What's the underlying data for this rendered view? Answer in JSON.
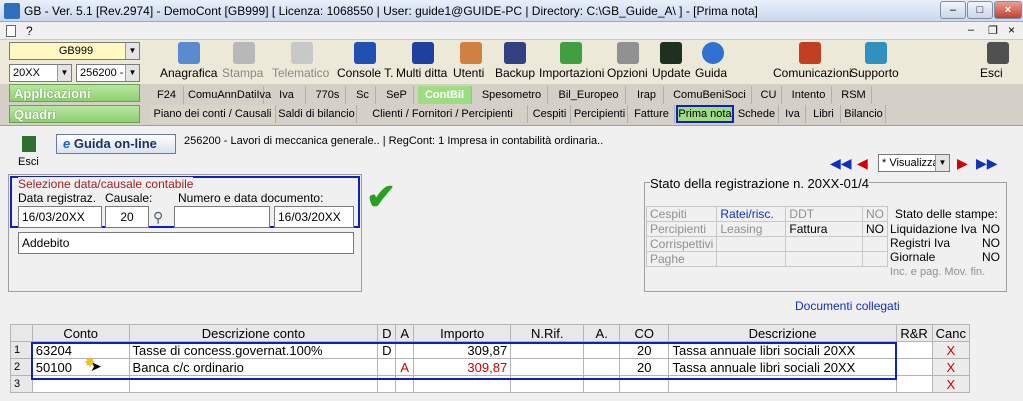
{
  "window": {
    "title": "GB - Ver. 5.1 [Rev.2974] - DemoCont [GB999]    [ Licenza: 1068550 | User: guide1@GUIDE-PC | Directory: C:\\GB_Guide_A\\ ] - [Prima nota]"
  },
  "menubar": {
    "help_label": "?"
  },
  "selectors": {
    "company": "GB999",
    "year": "20XX",
    "code": "256200 -"
  },
  "toolbar": {
    "buttons": [
      "Anagrafica",
      "Stampa",
      "Telematico",
      "Console T.",
      "Multi ditta",
      "Utenti",
      "Backup",
      "Importazioni",
      "Opzioni",
      "Update",
      "Guida",
      "Comunicazioni",
      "Supporto",
      "Esci"
    ]
  },
  "sections": {
    "applicazioni": "Applicazioni",
    "quadri": "Quadri"
  },
  "tabs_apps": [
    "F24",
    "ComuAnnDatiIva",
    "Iva",
    "770s",
    "Sc",
    "SeP",
    "ContBil",
    "Spesometro",
    "Bil_Europeo",
    "Irap",
    "ComuBeniSoci",
    "CU",
    "Intento",
    "RSM"
  ],
  "tabs_quadri": [
    "Piano dei conti / Causali",
    "Saldi di bilancio",
    "Clienti / Fornitori / Percipienti",
    "Cespiti",
    "Percipienti",
    "Fatture",
    "Prima nota",
    "Schede",
    "Iva",
    "Libri",
    "Bilancio"
  ],
  "panel": {
    "esci_label": "Esci",
    "guida_label": "Guida on-line",
    "info": "256200 - Lavori di meccanica generale..  | RegCont: 1 Impresa  in contabilità ordinaria..",
    "visualizza": "* Visualizza"
  },
  "selezione": {
    "legend": "Selezione data/causale contabile",
    "data_label": "Data registraz.",
    "causale_label": "Causale:",
    "numero_label": "Numero e data documento:",
    "data_value": "16/03/20XX",
    "causale_value": "20",
    "numero_value": "",
    "data_doc_value": "16/03/20XX",
    "descrizione_value": "Addebito"
  },
  "stato": {
    "legend": "Stato della registrazione n. 20XX-01/4",
    "rows": [
      [
        "Cespiti",
        "Ratei/risc.",
        "DDT",
        "NO"
      ],
      [
        "Percipienti",
        "Leasing",
        "Fattura",
        "NO"
      ],
      [
        "Corrispettivi",
        "",
        "",
        ""
      ],
      [
        "Paghe",
        "",
        "",
        ""
      ]
    ],
    "stampe_title": "Stato delle stampe:",
    "stampe": [
      [
        "Liquidazione Iva",
        "NO"
      ],
      [
        "Registri Iva",
        "NO"
      ],
      [
        "Giornale",
        "NO"
      ],
      [
        "Inc. e pag. Mov. fin.",
        ""
      ]
    ],
    "documenti_link": "Documenti collegati"
  },
  "grid": {
    "headers": [
      "",
      "Conto",
      "Descrizione conto",
      "D",
      "A",
      "Importo",
      "N.Rif.",
      "A.",
      "CO",
      "Descrizione",
      "R&R",
      "Canc"
    ],
    "rows": [
      [
        "1",
        "63204",
        "Tasse di concess.governat.100%",
        "D",
        "",
        "309,87",
        "",
        "",
        "20",
        "Tassa annuale libri sociali 20XX",
        "",
        "X"
      ],
      [
        "2",
        "50100",
        "Banca c/c ordinario",
        "",
        "A",
        "309,87",
        "",
        "",
        "20",
        "Tassa annuale libri sociali 20XX",
        "",
        "X"
      ],
      [
        "3",
        "",
        "",
        "",
        "",
        "",
        "",
        "",
        "",
        "",
        "",
        "X"
      ]
    ]
  }
}
